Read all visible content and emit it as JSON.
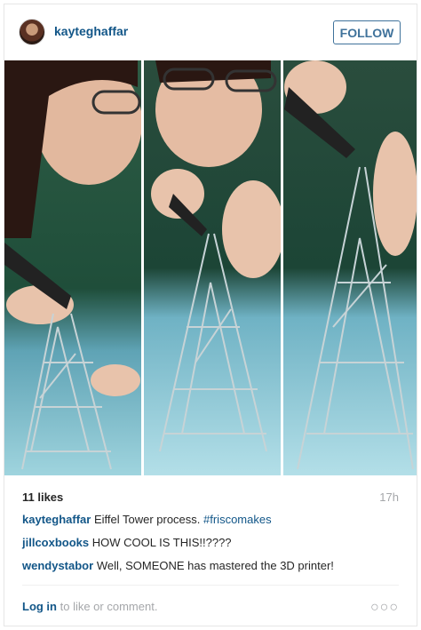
{
  "header": {
    "username": "kayteghaffar",
    "follow_label": "FOLLOW"
  },
  "photo": {
    "icon": "photo-image",
    "description_hidden": true
  },
  "post": {
    "likes": "11 likes",
    "timestamp": "17h",
    "comments": [
      {
        "user": "kayteghaffar",
        "text": "Eiffel Tower process. ",
        "tag": "#friscomakes"
      },
      {
        "user": "jillcoxbooks",
        "text": "HOW COOL IS THIS!!????",
        "tag": ""
      },
      {
        "user": "wendystabor",
        "text": "Well, SOMEONE has mastered the 3D printer!",
        "tag": ""
      }
    ]
  },
  "footer": {
    "login_label": "Log in",
    "login_suffix": " to like or comment.",
    "more_icon": "more-options-icon",
    "more_glyph": "○○○"
  },
  "colors": {
    "link": "#125688",
    "follow": "#3f729b",
    "muted": "#a5a7aa"
  }
}
